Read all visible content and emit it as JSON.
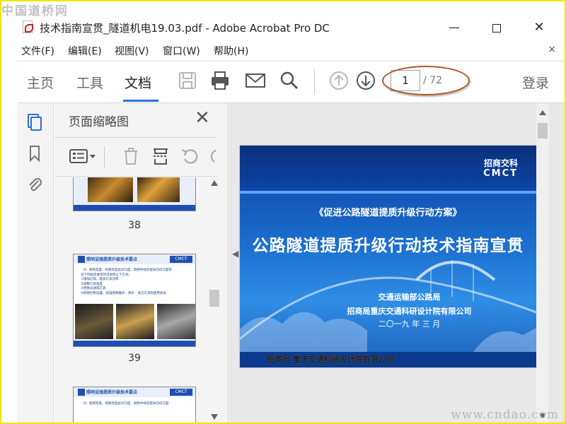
{
  "watermark": {
    "top": "中国道桥网",
    "bottom": "www.cndao.com"
  },
  "window": {
    "title": "技术指南宣贯_隧道机电19.03.pdf - Adobe Acrobat Pro DC",
    "minimize": "—",
    "close": "✕"
  },
  "menu": {
    "items": [
      {
        "label": "文件(F)"
      },
      {
        "label": "编辑(E)"
      },
      {
        "label": "视图(V)"
      },
      {
        "label": "窗口(W)"
      },
      {
        "label": "帮助(H)"
      }
    ],
    "close": "×"
  },
  "toolbar": {
    "tabs": [
      {
        "label": "主页"
      },
      {
        "label": "工具"
      },
      {
        "label": "文档"
      }
    ],
    "active_tab": "文档",
    "icons": [
      "save-icon",
      "print-icon",
      "email-icon",
      "search-icon",
      "page-up-icon",
      "page-down-icon"
    ],
    "current_page": "1",
    "total_pages": "/ 72",
    "login": "登录"
  },
  "left_rail": {
    "icons": [
      "page-thumbnails-icon",
      "bookmark-icon",
      "attachment-icon"
    ]
  },
  "thumbnail_panel": {
    "title": "页面缩略图",
    "close": "✕",
    "thumbnails": [
      {
        "page_label": "38"
      },
      {
        "page_label": "39",
        "heading": "照明设施提质升级技术要点",
        "lines": [
          "（4）照明亮度、照明亮度总均匀度、照明中线亮度纵向均匀度符",
          "合下列规定要求的可采用以下方式：",
          "①增加灯具、提高灯具功率",
          "②调整灯具角度",
          "③更换光源或灯具",
          "④照明控制设置、加强照明维护、养护、清洁灯具和使用寿命"
        ]
      },
      {
        "page_label": "",
        "heading": "照明设施提质升级技术要点",
        "lines": [
          "（5）照明亮度、照明亮度总均匀度、照明中线亮度纵向均匀度"
        ]
      }
    ],
    "mini_logo": "CMCT"
  },
  "document": {
    "slide": {
      "logo_cn": "招商交科",
      "logo_en": "CMCT",
      "subtitle": "《促进公路隧道提质升级行动方案》",
      "title": "公路隧道提质升级行动技术指南宣贯",
      "org1": "交通运输部公路局",
      "org2": "招商局重庆交通科研设计院有限公司",
      "date": "二〇一九 年 三 月",
      "footer": "招商局 重庆交通科研设计院有限公司"
    }
  }
}
